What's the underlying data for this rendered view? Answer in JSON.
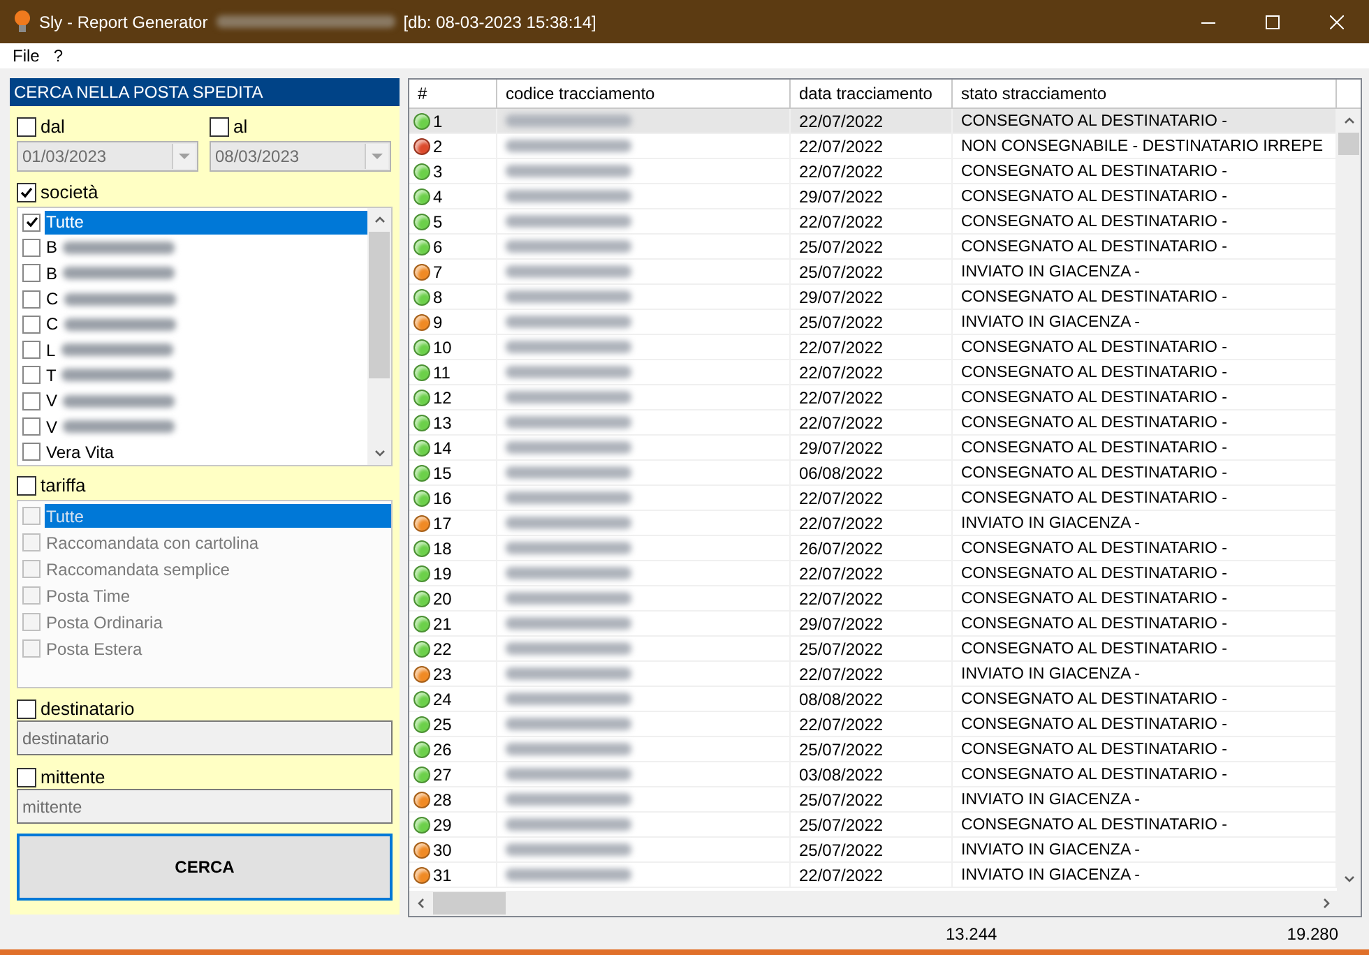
{
  "window": {
    "title": "Sly - Report Generator",
    "db_stamp": "[db: 08-03-2023 15:38:14]",
    "title_redacted": true
  },
  "menu": [
    "File",
    "?"
  ],
  "search_panel": {
    "title": "CERCA NELLA POSTA SPEDITA",
    "date_from": {
      "label": "dal",
      "checked": false,
      "value": "01/03/2023",
      "disabled": true
    },
    "date_to": {
      "label": "al",
      "checked": false,
      "value": "08/03/2023",
      "disabled": true
    },
    "company": {
      "label": "società",
      "checked": true,
      "disabled": false,
      "items": [
        {
          "label": "Tutte",
          "checked": true,
          "selected": true,
          "redacted": false
        },
        {
          "label": "B",
          "checked": false,
          "selected": false,
          "redacted": true
        },
        {
          "label": "B",
          "checked": false,
          "selected": false,
          "redacted": true
        },
        {
          "label": "C",
          "checked": false,
          "selected": false,
          "redacted": true
        },
        {
          "label": "C",
          "checked": false,
          "selected": false,
          "redacted": true
        },
        {
          "label": "L",
          "checked": false,
          "selected": false,
          "redacted": true
        },
        {
          "label": "T",
          "checked": false,
          "selected": false,
          "redacted": true
        },
        {
          "label": "V",
          "checked": false,
          "selected": false,
          "redacted": true
        },
        {
          "label": "V",
          "checked": false,
          "selected": false,
          "redacted": true
        },
        {
          "label": "Vera Vita",
          "checked": false,
          "selected": false,
          "redacted": false
        }
      ]
    },
    "rate": {
      "label": "tariffa",
      "checked": false,
      "disabled": true,
      "items": [
        {
          "label": "Tutte",
          "checked": false,
          "selected": true,
          "redacted": false
        },
        {
          "label": "Raccomandata con cartolina",
          "checked": false,
          "selected": false,
          "redacted": false
        },
        {
          "label": "Raccomandata semplice",
          "checked": false,
          "selected": false,
          "redacted": false
        },
        {
          "label": "Posta Time",
          "checked": false,
          "selected": false,
          "redacted": false
        },
        {
          "label": "Posta Ordinaria",
          "checked": false,
          "selected": false,
          "redacted": false
        },
        {
          "label": "Posta Estera",
          "checked": false,
          "selected": false,
          "redacted": false
        }
      ]
    },
    "recipient": {
      "label": "destinatario",
      "checked": false,
      "placeholder": "destinatario",
      "disabled": true
    },
    "sender": {
      "label": "mittente",
      "checked": false,
      "placeholder": "mittente",
      "disabled": true
    },
    "search_button": "CERCA"
  },
  "table": {
    "columns": [
      "#",
      "codice tracciamento",
      "data tracciamento",
      "stato stracciamento"
    ],
    "rows": [
      {
        "number": "1",
        "date": "22/07/2022",
        "status": "CONSEGNATO AL DESTINATARIO -",
        "color": "#6cd04a",
        "selected": true
      },
      {
        "number": "2",
        "date": "22/07/2022",
        "status": "NON CONSEGNABILE - DESTINATARIO IRREPE",
        "color": "#dc4a2c",
        "selected": false
      },
      {
        "number": "3",
        "date": "22/07/2022",
        "status": "CONSEGNATO AL DESTINATARIO -",
        "color": "#6cd04a",
        "selected": false
      },
      {
        "number": "4",
        "date": "29/07/2022",
        "status": "CONSEGNATO AL DESTINATARIO -",
        "color": "#6cd04a",
        "selected": false
      },
      {
        "number": "5",
        "date": "22/07/2022",
        "status": "CONSEGNATO AL DESTINATARIO -",
        "color": "#6cd04a",
        "selected": false
      },
      {
        "number": "6",
        "date": "25/07/2022",
        "status": "CONSEGNATO AL DESTINATARIO -",
        "color": "#6cd04a",
        "selected": false
      },
      {
        "number": "7",
        "date": "25/07/2022",
        "status": "INVIATO IN GIACENZA -",
        "color": "#f08a24",
        "selected": false
      },
      {
        "number": "8",
        "date": "29/07/2022",
        "status": "CONSEGNATO AL DESTINATARIO -",
        "color": "#6cd04a",
        "selected": false
      },
      {
        "number": "9",
        "date": "25/07/2022",
        "status": "INVIATO IN GIACENZA -",
        "color": "#f08a24",
        "selected": false
      },
      {
        "number": "10",
        "date": "22/07/2022",
        "status": "CONSEGNATO AL DESTINATARIO -",
        "color": "#6cd04a",
        "selected": false
      },
      {
        "number": "11",
        "date": "22/07/2022",
        "status": "CONSEGNATO AL DESTINATARIO -",
        "color": "#6cd04a",
        "selected": false
      },
      {
        "number": "12",
        "date": "22/07/2022",
        "status": "CONSEGNATO AL DESTINATARIO -",
        "color": "#6cd04a",
        "selected": false
      },
      {
        "number": "13",
        "date": "22/07/2022",
        "status": "CONSEGNATO AL DESTINATARIO -",
        "color": "#6cd04a",
        "selected": false
      },
      {
        "number": "14",
        "date": "29/07/2022",
        "status": "CONSEGNATO AL DESTINATARIO -",
        "color": "#6cd04a",
        "selected": false
      },
      {
        "number": "15",
        "date": "06/08/2022",
        "status": "CONSEGNATO AL DESTINATARIO -",
        "color": "#6cd04a",
        "selected": false
      },
      {
        "number": "16",
        "date": "22/07/2022",
        "status": "CONSEGNATO AL DESTINATARIO -",
        "color": "#6cd04a",
        "selected": false
      },
      {
        "number": "17",
        "date": "22/07/2022",
        "status": "INVIATO IN GIACENZA -",
        "color": "#f08a24",
        "selected": false
      },
      {
        "number": "18",
        "date": "26/07/2022",
        "status": "CONSEGNATO AL DESTINATARIO -",
        "color": "#6cd04a",
        "selected": false
      },
      {
        "number": "19",
        "date": "22/07/2022",
        "status": "CONSEGNATO AL DESTINATARIO -",
        "color": "#6cd04a",
        "selected": false
      },
      {
        "number": "20",
        "date": "22/07/2022",
        "status": "CONSEGNATO AL DESTINATARIO -",
        "color": "#6cd04a",
        "selected": false
      },
      {
        "number": "21",
        "date": "29/07/2022",
        "status": "CONSEGNATO AL DESTINATARIO -",
        "color": "#6cd04a",
        "selected": false
      },
      {
        "number": "22",
        "date": "25/07/2022",
        "status": "CONSEGNATO AL DESTINATARIO -",
        "color": "#6cd04a",
        "selected": false
      },
      {
        "number": "23",
        "date": "22/07/2022",
        "status": "INVIATO IN GIACENZA -",
        "color": "#f08a24",
        "selected": false
      },
      {
        "number": "24",
        "date": "08/08/2022",
        "status": "CONSEGNATO AL DESTINATARIO -",
        "color": "#6cd04a",
        "selected": false
      },
      {
        "number": "25",
        "date": "22/07/2022",
        "status": "CONSEGNATO AL DESTINATARIO -",
        "color": "#6cd04a",
        "selected": false
      },
      {
        "number": "26",
        "date": "25/07/2022",
        "status": "CONSEGNATO AL DESTINATARIO -",
        "color": "#6cd04a",
        "selected": false
      },
      {
        "number": "27",
        "date": "03/08/2022",
        "status": "CONSEGNATO AL DESTINATARIO -",
        "color": "#6cd04a",
        "selected": false
      },
      {
        "number": "28",
        "date": "25/07/2022",
        "status": "INVIATO IN GIACENZA -",
        "color": "#f08a24",
        "selected": false
      },
      {
        "number": "29",
        "date": "25/07/2022",
        "status": "CONSEGNATO AL DESTINATARIO -",
        "color": "#6cd04a",
        "selected": false
      },
      {
        "number": "30",
        "date": "25/07/2022",
        "status": "INVIATO IN GIACENZA -",
        "color": "#f08a24",
        "selected": false
      },
      {
        "number": "31",
        "date": "22/07/2022",
        "status": "INVIATO IN GIACENZA -",
        "color": "#f08a24",
        "selected": false
      }
    ]
  },
  "status_bar": [
    "13.244",
    "19.280"
  ]
}
